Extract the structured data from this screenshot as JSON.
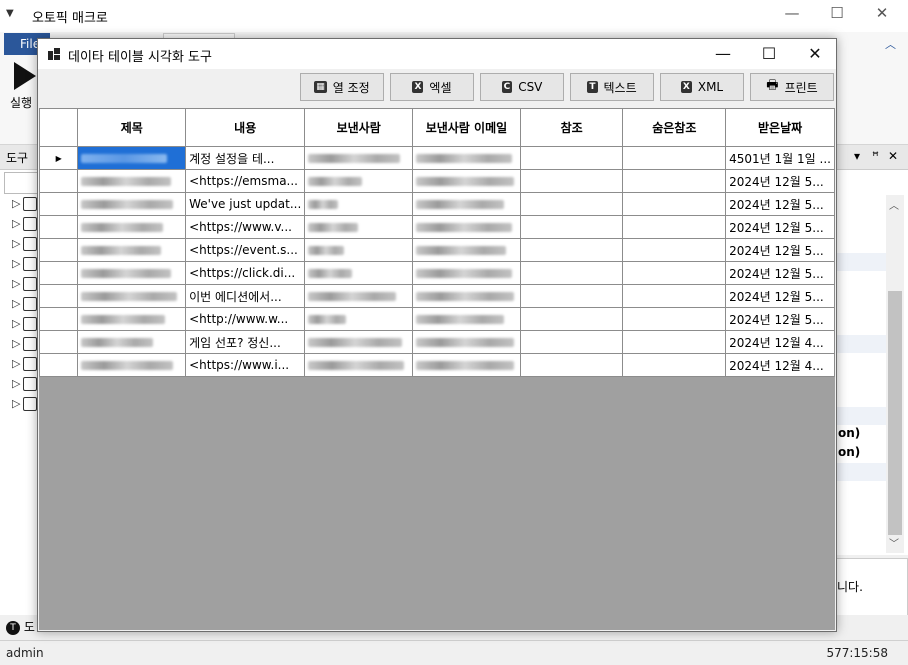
{
  "main_app": {
    "title": "오토픽 매크로",
    "file_tab": "File",
    "run_label": "실행",
    "tool_panel_title": "도구",
    "bottom_tab_label": "도",
    "right_panel_texts": [
      "on)",
      "on)"
    ],
    "right_bottom_text": "니다.",
    "status_user": "admin",
    "status_time": "577:15:58"
  },
  "dialog": {
    "title": "데이타 테이블 시각화 도구",
    "toolbar": {
      "fit_columns": "열 조정",
      "excel": "엑셀",
      "csv": "CSV",
      "text": "텍스트",
      "xml": "XML",
      "print": "프린트"
    },
    "columns": [
      "제목",
      "내용",
      "보낸사람",
      "보낸사람 이메일",
      "참조",
      "숨은참조",
      "받은날짜"
    ],
    "rows": [
      {
        "content": "계정 설정을 테...",
        "received": "4501년 1월 1일 ..."
      },
      {
        "content": " <https://emsma...",
        "received": "2024년 12월 5..."
      },
      {
        "content": "We've just updat...",
        "received": "2024년 12월 5..."
      },
      {
        "content": " <https://www.v...",
        "received": "2024년 12월 5..."
      },
      {
        "content": " <https://event.s...",
        "received": "2024년 12월 5..."
      },
      {
        "content": " <https://click.di...",
        "received": "2024년 12월 5..."
      },
      {
        "content": "이번 에디션에서...",
        "received": "2024년 12월 5..."
      },
      {
        "content": " <http://www.w...",
        "received": "2024년 12월 5..."
      },
      {
        "content": " 게임 선포? 정신...",
        "received": "2024년 12월 4..."
      },
      {
        "content": "  <https://www.i...",
        "received": "2024년 12월 4..."
      }
    ]
  }
}
